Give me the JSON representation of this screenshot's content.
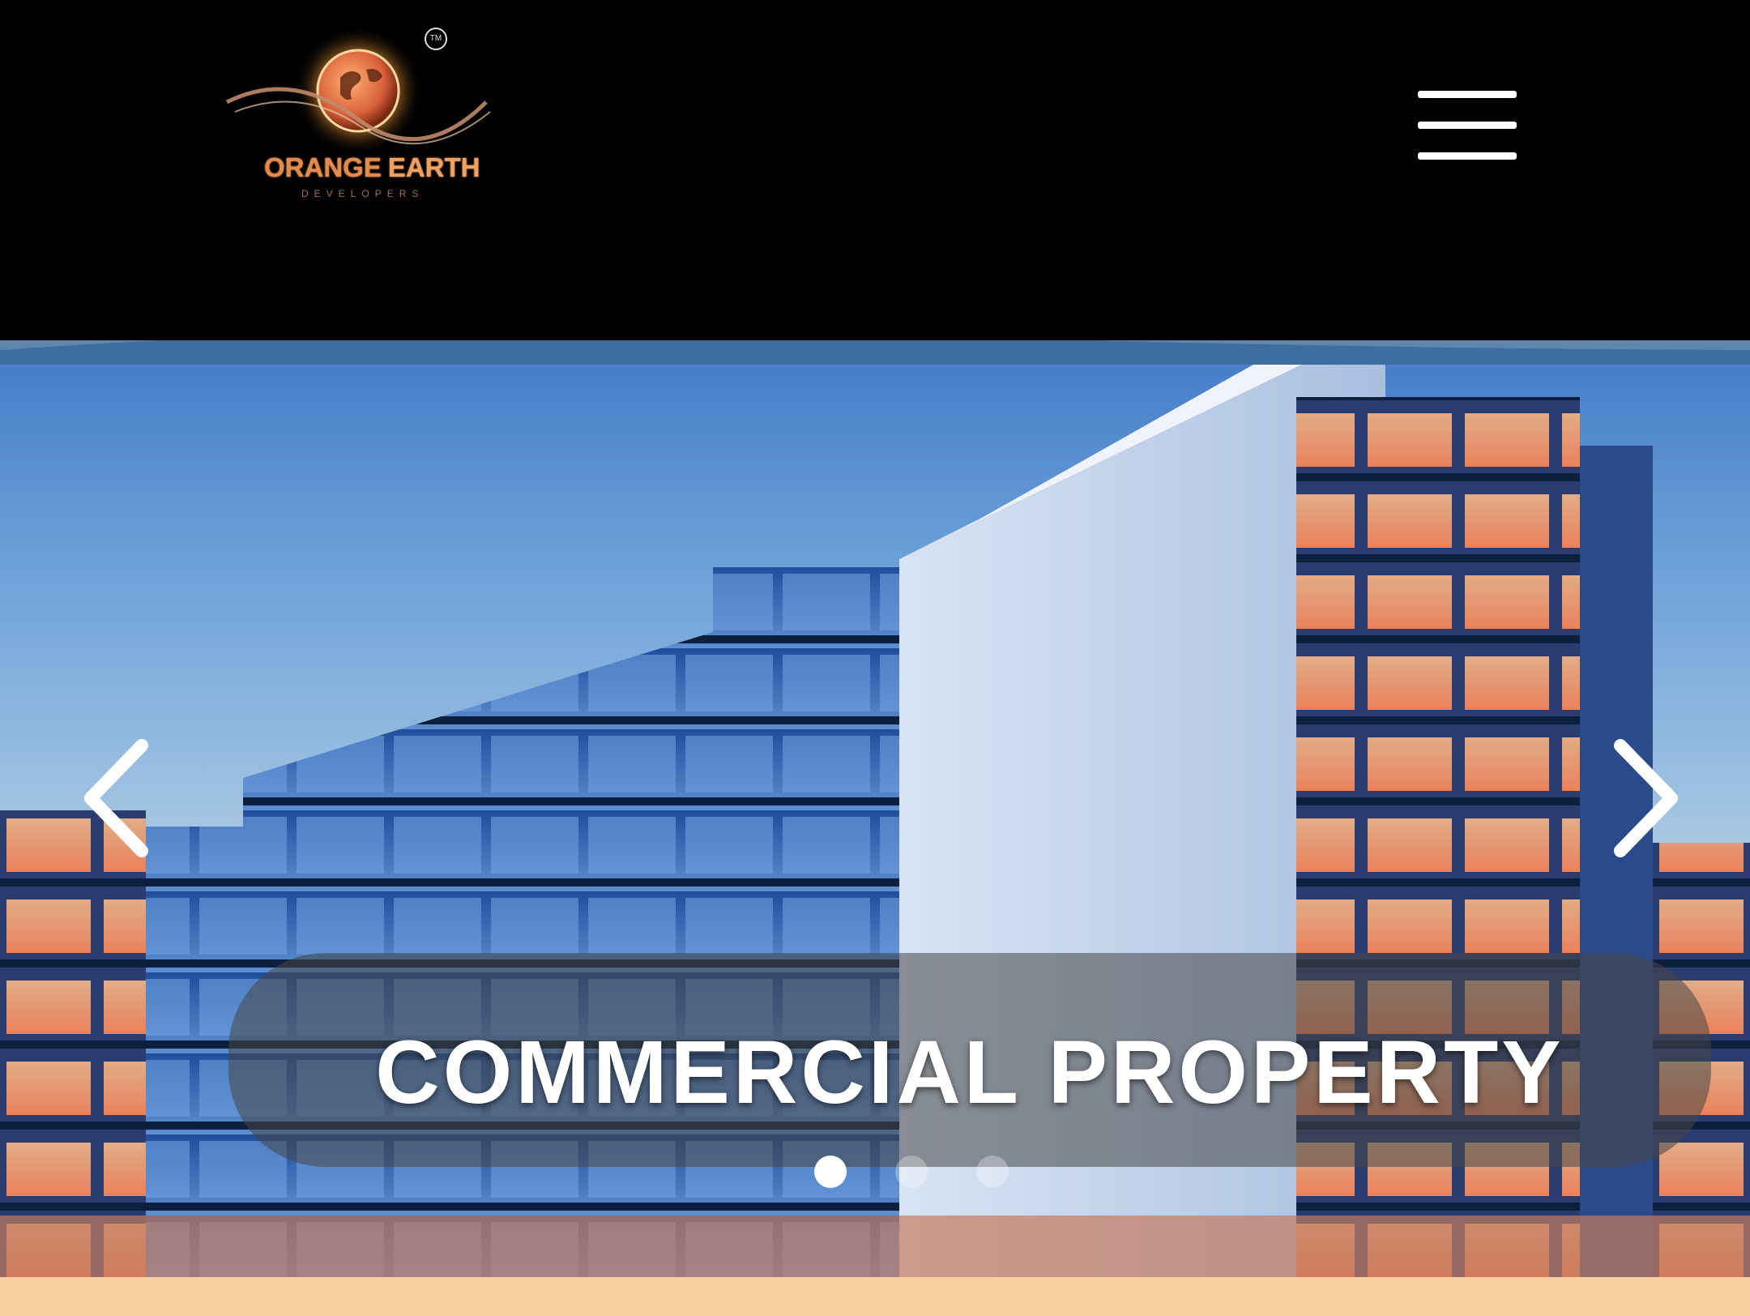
{
  "header": {
    "logo": {
      "name": "ORANGE",
      "name_accent": "EARTH",
      "tagline": "DEVELOPERS",
      "trademark": "TM"
    },
    "menu_icon": "hamburger-menu-icon"
  },
  "hero": {
    "slide_title": "COMMERCIAL PROPERTY",
    "prev_icon": "chevron-left-icon",
    "next_icon": "chevron-right-icon",
    "slide_count": 3,
    "active_slide": 1
  },
  "colors": {
    "header_bg": "#000000",
    "brand_orange": "#e58a4a",
    "footer_strip": "#f7cf9f"
  }
}
